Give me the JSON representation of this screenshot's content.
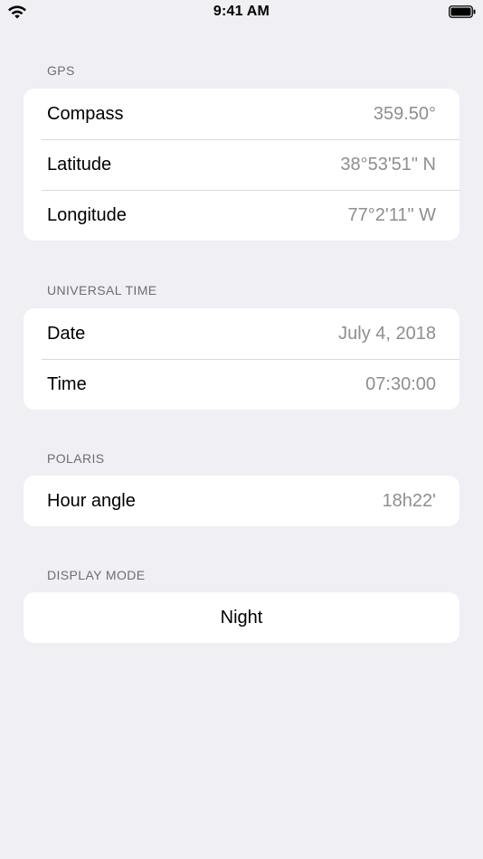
{
  "status_bar": {
    "time": "9:41 AM",
    "wifi_icon": "wifi-icon",
    "battery_icon": "battery-icon"
  },
  "gps": {
    "header": "GPS",
    "rows": [
      {
        "label": "Compass",
        "value": "359.50°"
      },
      {
        "label": "Latitude",
        "value": "38°53'51\" N"
      },
      {
        "label": "Longitude",
        "value": "77°2'11\" W"
      }
    ]
  },
  "universal_time": {
    "header": "UNIVERSAL TIME",
    "rows": [
      {
        "label": "Date",
        "value": "July 4, 2018"
      },
      {
        "label": "Time",
        "value": "07:30:00"
      }
    ]
  },
  "polaris": {
    "header": "POLARIS",
    "rows": [
      {
        "label": "Hour angle",
        "value": "18h22'"
      }
    ]
  },
  "display_mode": {
    "header": "DISPLAY MODE",
    "button_label": "Night"
  },
  "colors": {
    "background": "#efeff4",
    "cell_background": "#ffffff",
    "value_text": "#8e8e93",
    "header_text": "#6d6d72"
  }
}
